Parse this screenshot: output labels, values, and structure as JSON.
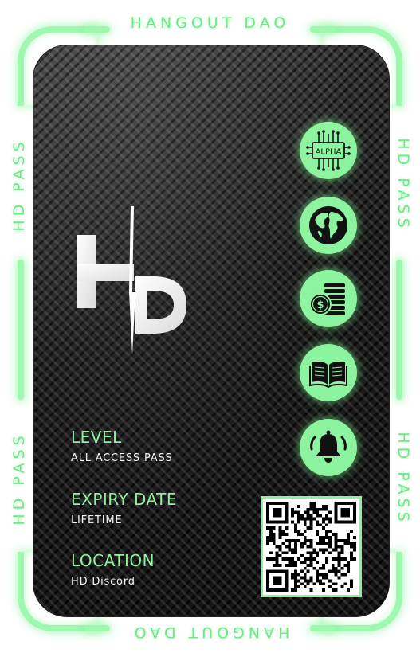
{
  "frame": {
    "top_text": "HANGOUT DAO",
    "bottom_text": "HANGOUT DAO",
    "side_text": "HD PASS",
    "glow_color": "#9ff8af",
    "text_color": "#6ee887"
  },
  "card": {
    "logo_text": "HD",
    "accent_color": "#8ef29d",
    "fields": [
      {
        "label": "LEVEL",
        "value": "ALL ACCESS PASS"
      },
      {
        "label": "EXPIRY DATE",
        "value": "LIFETIME"
      },
      {
        "label": "LOCATION",
        "value": "HD Discord"
      }
    ],
    "badges": [
      {
        "icon": "alpha-chip-icon",
        "text": "ALPHA"
      },
      {
        "icon": "globe-icon"
      },
      {
        "icon": "coins-icon"
      },
      {
        "icon": "book-icon"
      },
      {
        "icon": "bell-icon"
      }
    ],
    "qr_icon": "qr-code-icon"
  }
}
